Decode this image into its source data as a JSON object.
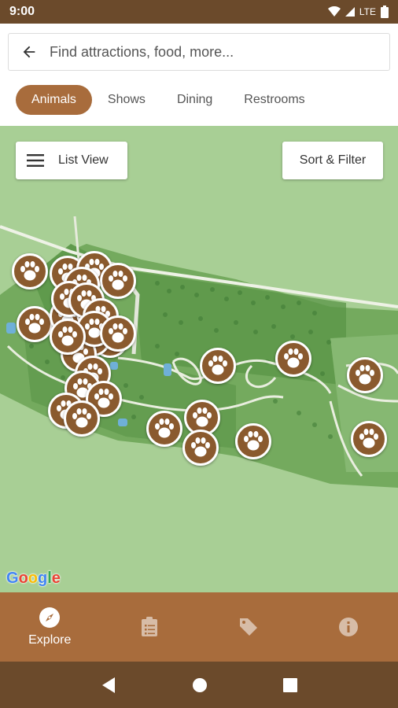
{
  "status_bar": {
    "time": "9:00",
    "network": "LTE"
  },
  "search": {
    "placeholder": "Find attractions, food, more..."
  },
  "categories": [
    {
      "label": "Animals",
      "active": true
    },
    {
      "label": "Shows",
      "active": false
    },
    {
      "label": "Dining",
      "active": false
    },
    {
      "label": "Restrooms",
      "active": false
    }
  ],
  "map": {
    "list_view_label": "List View",
    "sort_filter_label": "Sort & Filter",
    "attribution": "Google",
    "pin_icon": "paw-icon",
    "pin_count": 30
  },
  "bottom_nav": [
    {
      "label": "Explore",
      "icon": "compass-icon",
      "active": true
    },
    {
      "label": "",
      "icon": "clipboard-icon",
      "active": false
    },
    {
      "label": "",
      "icon": "tag-icon",
      "active": false
    },
    {
      "label": "",
      "icon": "info-icon",
      "active": false
    }
  ],
  "system_nav": [
    "back-icon",
    "home-icon",
    "recents-icon"
  ],
  "colors": {
    "brand_dark": "#6b4a2b",
    "brand": "#a86c3c",
    "pin": "#8a5a2e",
    "map_bg": "#a8cf95",
    "park": "#6fa95a"
  }
}
